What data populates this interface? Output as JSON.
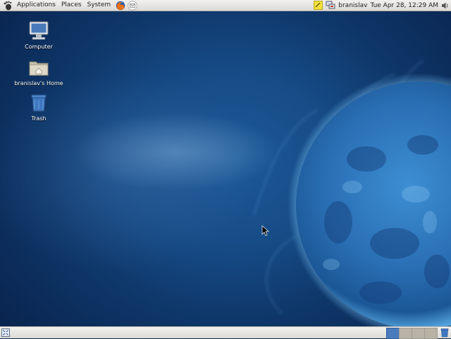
{
  "top_panel": {
    "menus": [
      "Applications",
      "Places",
      "System"
    ],
    "launchers": [
      "firefox-icon",
      "mail-icon"
    ],
    "tray": {
      "notes_icon": "sticky-note-icon",
      "network_icon": "network-icon",
      "user": "branislav",
      "clock": "Tue Apr 28, 12:29 AM",
      "volume_icon": "volume-icon"
    }
  },
  "desktop": {
    "icons": [
      {
        "label": "Computer",
        "icon": "computer-icon"
      },
      {
        "label": "branislav's Home",
        "icon": "home-folder-icon"
      },
      {
        "label": "Trash",
        "icon": "trash-icon"
      }
    ]
  },
  "bottom_panel": {
    "workspaces": 4,
    "active_workspace": 1
  },
  "colors": {
    "panel": "#e6e4df",
    "desktop_blue": "#164b86",
    "workspace_active": "#4a7bbd"
  }
}
